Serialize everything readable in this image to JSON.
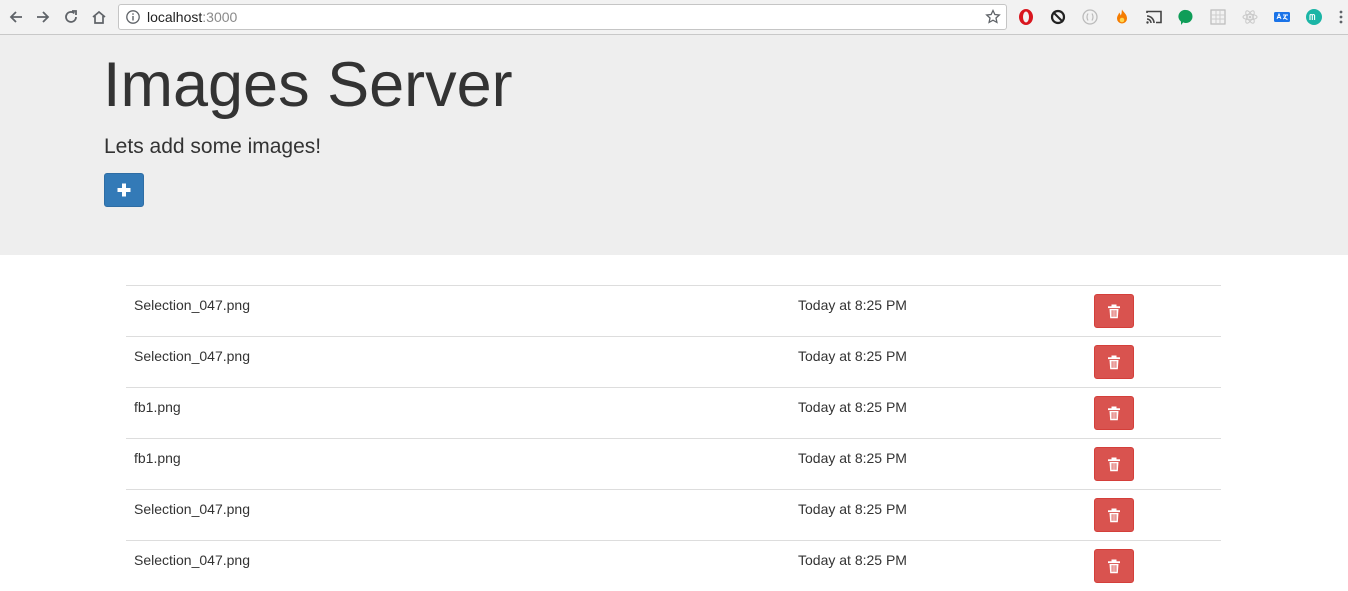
{
  "browser": {
    "url_host": "localhost",
    "url_port": ":3000",
    "nav_icons": [
      "back-icon",
      "forward-icon",
      "reload-icon",
      "home-icon"
    ],
    "extension_icons": [
      "opera-icon",
      "sync-icon",
      "circle-ext-icon",
      "fire-ext-icon",
      "cast-icon",
      "green-chat-icon",
      "grid-ext-icon",
      "react-icon",
      "translate-icon",
      "m-ext-icon",
      "menu-icon"
    ]
  },
  "header": {
    "title": "Images Server",
    "subtitle": "Lets add some images!",
    "add_icon": "plus-icon",
    "colors": {
      "background": "#eeeeee",
      "primary": "#337ab7"
    }
  },
  "files": {
    "delete_icon": "trash-icon",
    "colors": {
      "danger": "#d9534f"
    },
    "rows": [
      {
        "name": "Selection_047.png",
        "date": "Today at 8:25 PM"
      },
      {
        "name": "Selection_047.png",
        "date": "Today at 8:25 PM"
      },
      {
        "name": "fb1.png",
        "date": "Today at 8:25 PM"
      },
      {
        "name": "fb1.png",
        "date": "Today at 8:25 PM"
      },
      {
        "name": "Selection_047.png",
        "date": "Today at 8:25 PM"
      },
      {
        "name": "Selection_047.png",
        "date": "Today at 8:25 PM"
      }
    ]
  }
}
